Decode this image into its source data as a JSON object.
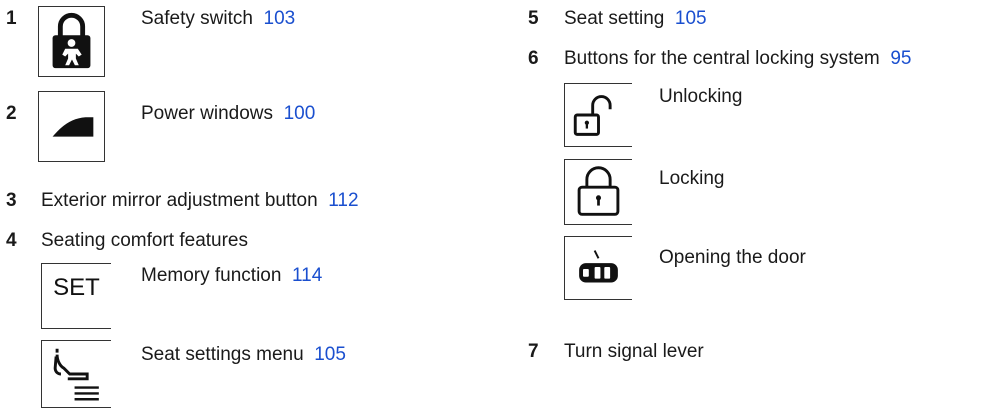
{
  "left": {
    "item1": {
      "num": "1",
      "label": "Safety switch",
      "ref": "103",
      "icon": "child-lock-icon"
    },
    "item2": {
      "num": "2",
      "label": "Power windows",
      "ref": "100",
      "icon": "power-window-icon"
    },
    "item3": {
      "num": "3",
      "label": "Exterior mirror adjustment button",
      "ref": "112"
    },
    "item4": {
      "num": "4",
      "label": "Seating comfort features",
      "sub": [
        {
          "label": "Memory function",
          "ref": "114",
          "icon": "set-icon",
          "icon_text": "SET"
        },
        {
          "label": "Seat settings menu",
          "ref": "105",
          "icon": "seat-settings-icon"
        }
      ]
    }
  },
  "right": {
    "item5": {
      "num": "5",
      "label": "Seat setting",
      "ref": "105"
    },
    "item6": {
      "num": "6",
      "label": "Buttons for the central locking system",
      "ref": "95",
      "sub": [
        {
          "label": "Unlocking",
          "icon": "unlock-icon"
        },
        {
          "label": "Locking",
          "icon": "lock-icon"
        },
        {
          "label": "Opening the door",
          "icon": "door-open-icon"
        }
      ]
    },
    "item7": {
      "num": "7",
      "label": "Turn signal lever"
    }
  },
  "colors": {
    "link": "#1a4fcf",
    "text": "#1a1a1a"
  }
}
